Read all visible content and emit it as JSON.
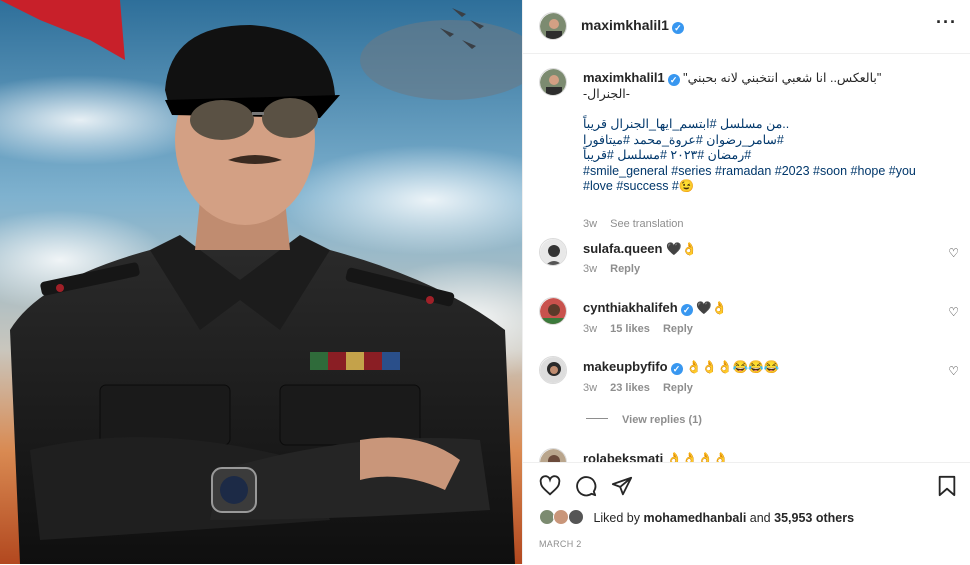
{
  "post": {
    "username": "maximkhalil1",
    "verified_mark": "✓",
    "more_icon": "more-horizontal-icon",
    "photo_alt": "photo-of-man-in-black-military-uniform"
  },
  "caption": {
    "username": "maximkhalil1",
    "line1": "\"بالعكس.. انا شعبي انتخبني لانه بحبني\"",
    "line2": "-الجنرال-",
    "line3": "..من مسلسل #ابتسم_ايها_الجنرال قريباً",
    "line4": "#سامر_رضوان #عروة_محمد #ميتافورا",
    "line5": "#رمضان #٢٠٢٣ #مسلسل #قريباً",
    "line6": "#smile_general #series #ramadan #2023 #soon #hope #you",
    "line7": "#love #success #😉",
    "time": "3w",
    "see_translation": "See translation"
  },
  "comments": [
    {
      "username": "sulafa.queen",
      "verified": false,
      "text": "🖤👌",
      "time": "3w",
      "likes": "",
      "reply": "Reply"
    },
    {
      "username": "cynthiakhalifeh",
      "verified": true,
      "text": "🖤👌",
      "time": "3w",
      "likes": "15 likes",
      "reply": "Reply"
    },
    {
      "username": "makeupbyfifo",
      "verified": true,
      "text": "👌👌👌😂😂😂",
      "time": "3w",
      "likes": "23 likes",
      "reply": "Reply",
      "view_replies": "View replies (1)"
    },
    {
      "username": "rolabeksmati",
      "verified": false,
      "text": "👌👌👌👌",
      "time": "",
      "likes": "",
      "reply": ""
    }
  ],
  "actions": {
    "like_icon": "heart-icon",
    "comment_icon": "comment-icon",
    "share_icon": "share-icon",
    "save_icon": "bookmark-icon"
  },
  "likes": {
    "prefix": "Liked by",
    "user": "mohamedhanbali",
    "middle": "and",
    "count": "35,953 others"
  },
  "date": "MARCH 2",
  "colors": {
    "hashtag": "#00376b",
    "verified": "#3897f0",
    "muted": "#8e8e8e"
  }
}
